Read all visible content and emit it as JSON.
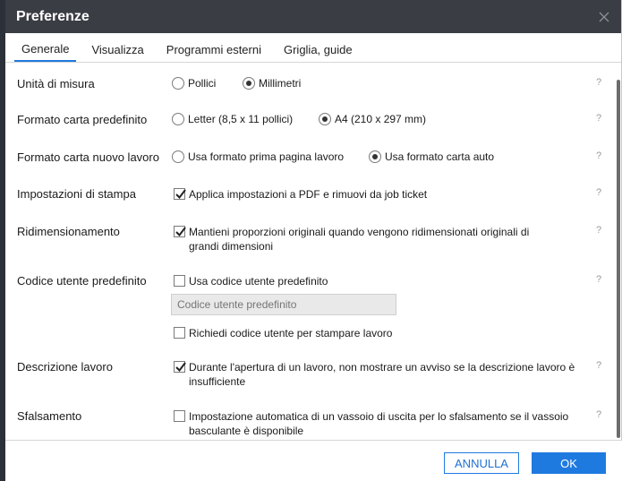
{
  "window": {
    "title": "Preferenze"
  },
  "tabs": [
    {
      "label": "Generale"
    },
    {
      "label": "Visualizza"
    },
    {
      "label": "Programmi esterni"
    },
    {
      "label": "Griglia, guide"
    }
  ],
  "active_tab": "Generale",
  "help_glyph": "?",
  "settings": {
    "units": {
      "label": "Unità di misura",
      "options": [
        {
          "label": "Pollici",
          "selected": false
        },
        {
          "label": "Millimetri",
          "selected": true
        }
      ]
    },
    "default_paper": {
      "label": "Formato carta predefinito",
      "options": [
        {
          "label": "Letter (8,5 x 11 pollici)",
          "selected": false
        },
        {
          "label": "A4 (210 x 297 mm)",
          "selected": true
        }
      ]
    },
    "new_job_paper": {
      "label": "Formato carta nuovo lavoro",
      "options": [
        {
          "label": "Usa formato prima pagina lavoro",
          "selected": false
        },
        {
          "label": "Usa formato carta auto",
          "selected": true
        }
      ]
    },
    "print_settings": {
      "label": "Impostazioni di stampa",
      "checkbox": {
        "text": "Applica impostazioni a PDF e rimuovi da job ticket",
        "checked": true
      }
    },
    "resizing": {
      "label": "Ridimensionamento",
      "checkbox": {
        "text": "Mantieni proporzioni originali quando vengono ridimensionati originali di grandi dimensioni",
        "checked": true
      }
    },
    "default_user_code": {
      "label": "Codice utente predefinito",
      "checkbox": {
        "text": "Usa codice utente predefinito",
        "checked": false
      },
      "input": {
        "placeholder": "Codice utente predefinito",
        "value": ""
      },
      "checkbox2": {
        "text": "Richiedi codice utente per stampare lavoro",
        "checked": false
      }
    },
    "job_description": {
      "label": "Descrizione lavoro",
      "checkbox": {
        "text": "Durante l'apertura di un lavoro, non mostrare un avviso se la descrizione lavoro è insufficiente",
        "checked": true
      }
    },
    "offset": {
      "label": "Sfalsamento",
      "checkbox": {
        "text": "Impostazione automatica di un vassoio di uscita per lo sfalsamento se il vassoio basculante è disponibile",
        "checked": false
      }
    }
  },
  "footer": {
    "cancel_label": "ANNULLA",
    "ok_label": "OK"
  },
  "colors": {
    "titlebar": "#3a3d44",
    "accent": "#1f7ae0",
    "help": "#9a9a9a"
  }
}
